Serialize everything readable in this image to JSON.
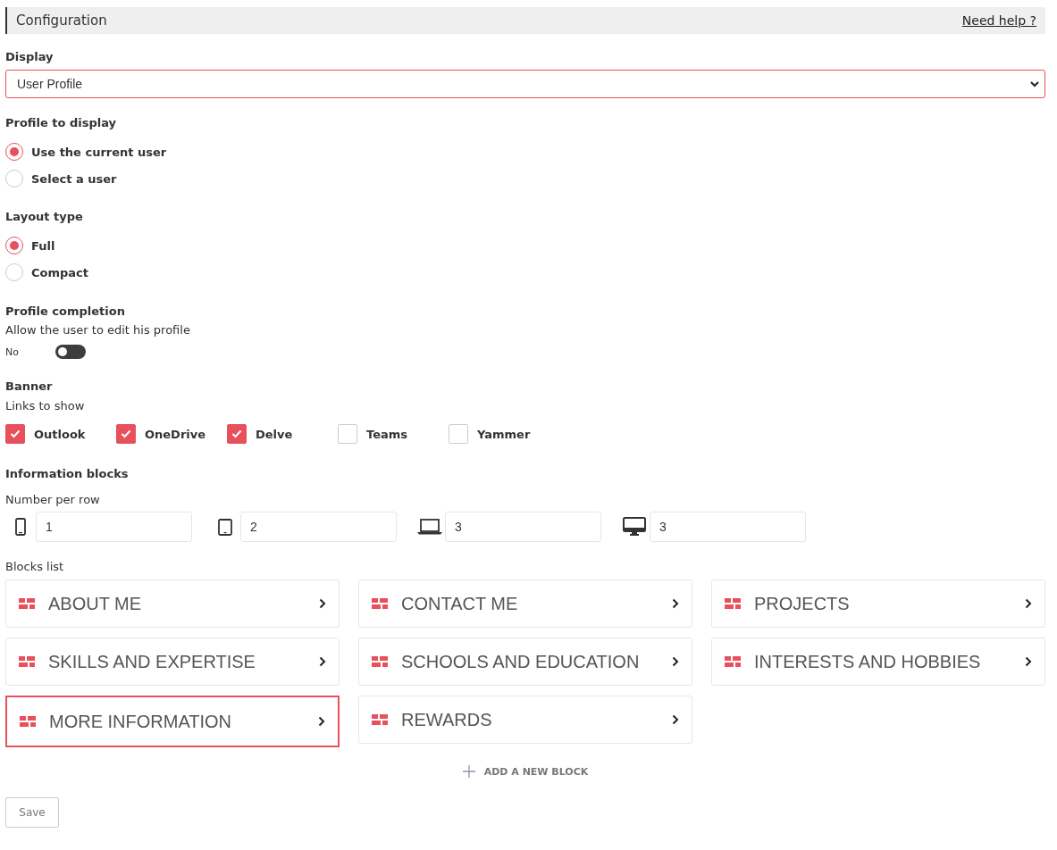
{
  "header": {
    "title": "Configuration",
    "help_link": "Need help ?"
  },
  "display": {
    "label": "Display",
    "value": "User Profile"
  },
  "profile": {
    "label": "Profile to display",
    "options": [
      {
        "label": "Use the current user",
        "selected": true
      },
      {
        "label": "Select a user",
        "selected": false
      }
    ]
  },
  "layout": {
    "label": "Layout type",
    "options": [
      {
        "label": "Full",
        "selected": true
      },
      {
        "label": "Compact",
        "selected": false
      }
    ]
  },
  "completion": {
    "label": "Profile completion",
    "description": "Allow the user to edit his profile",
    "toggle": {
      "label": "No",
      "on": false
    }
  },
  "banner": {
    "label": "Banner",
    "sublabel": "Links to show",
    "links": [
      {
        "label": "Outlook",
        "checked": true
      },
      {
        "label": "OneDrive",
        "checked": true
      },
      {
        "label": "Delve",
        "checked": true
      },
      {
        "label": "Teams",
        "checked": false
      },
      {
        "label": "Yammer",
        "checked": false
      }
    ]
  },
  "blocks": {
    "label": "Information blocks",
    "per_row_label": "Number per row",
    "per_row": [
      {
        "kind": "phone",
        "value": "1"
      },
      {
        "kind": "tablet",
        "value": "2"
      },
      {
        "kind": "laptop",
        "value": "3"
      },
      {
        "kind": "desktop",
        "value": "3"
      }
    ],
    "list_label": "Blocks list",
    "items": [
      {
        "label": "ABOUT ME",
        "selected": false
      },
      {
        "label": "CONTACT ME",
        "selected": false
      },
      {
        "label": "PROJECTS",
        "selected": false
      },
      {
        "label": "SKILLS AND EXPERTISE",
        "selected": false
      },
      {
        "label": "SCHOOLS AND EDUCATION",
        "selected": false
      },
      {
        "label": "INTERESTS AND HOBBIES",
        "selected": false
      },
      {
        "label": "MORE INFORMATION",
        "selected": true
      },
      {
        "label": "REWARDS",
        "selected": false
      }
    ],
    "add_label": "ADD A NEW BLOCK"
  },
  "save": "Save"
}
